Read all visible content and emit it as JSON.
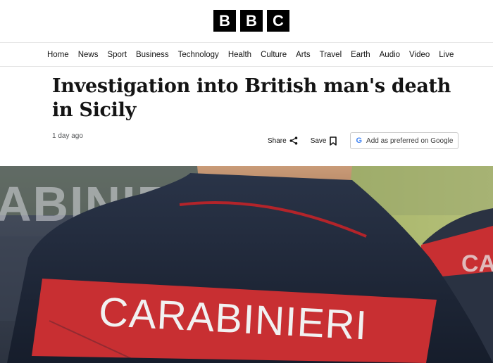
{
  "brand": {
    "letters": [
      "B",
      "B",
      "C"
    ]
  },
  "nav": {
    "items": [
      "Home",
      "News",
      "Sport",
      "Business",
      "Technology",
      "Health",
      "Culture",
      "Arts",
      "Travel",
      "Earth",
      "Audio",
      "Video",
      "Live"
    ]
  },
  "article": {
    "headline": "Investigation into British man's death in Sicily",
    "timestamp": "1 day ago",
    "share_label": "Share",
    "save_label": "Save",
    "google_label": "Add as preferred on Google"
  },
  "hero": {
    "jacket_text": "CARABINIERI",
    "background_text_left": "ABINIER",
    "background_text_right": "CA"
  },
  "colors": {
    "jacket": "#1f2a3e",
    "patch": "#c82f32",
    "patch_text": "#f1f1f1",
    "bg_green": "#a4b264",
    "brand_black": "#000000"
  },
  "icons": [
    "share-icon",
    "bookmark-icon",
    "google-icon"
  ]
}
